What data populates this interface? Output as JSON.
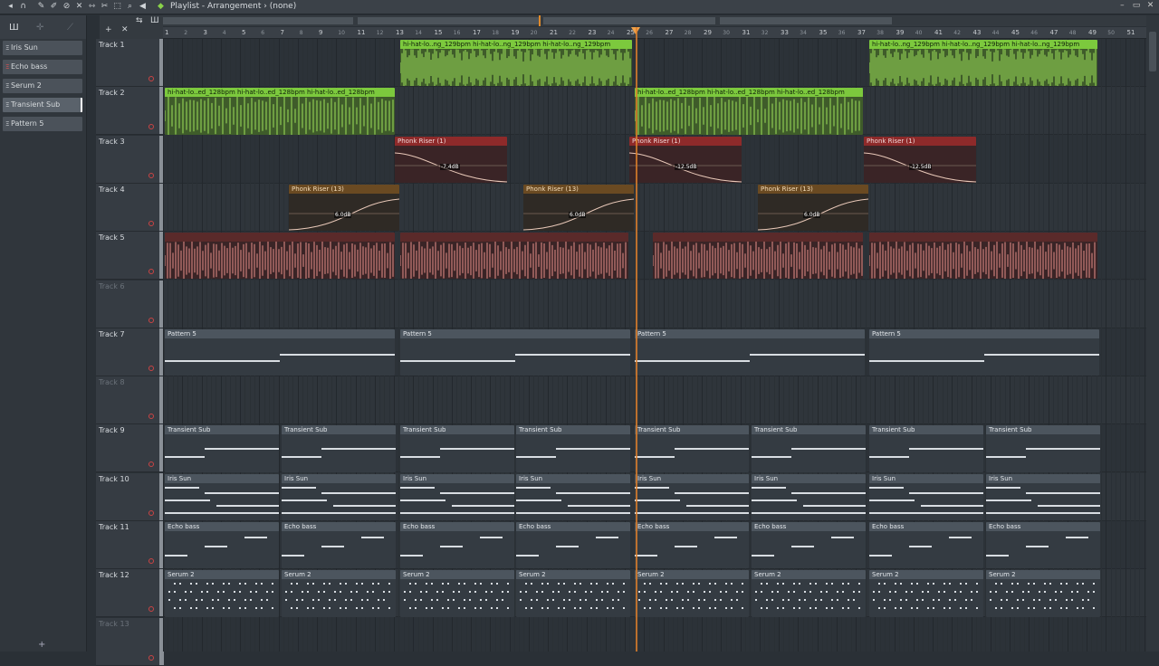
{
  "window": {
    "title": "Playlist - Arrangement",
    "subtitle": "(none)",
    "separator": "›"
  },
  "toolbar_icons": [
    "menu-icon",
    "magnet-icon",
    "pencil-icon",
    "brush-icon",
    "mute-icon",
    "delete-icon",
    "slip-icon",
    "select-icon",
    "zoom-icon",
    "speaker-icon"
  ],
  "picker": {
    "items": [
      {
        "label": "Iris Sun"
      },
      {
        "label": "Echo bass"
      },
      {
        "label": "Serum 2"
      },
      {
        "label": "Transient Sub",
        "selected": true
      },
      {
        "label": "Pattern 5"
      }
    ]
  },
  "ruler": {
    "bars": [
      "1",
      "3",
      "5",
      "7",
      "9",
      "11",
      "13",
      "15",
      "17",
      "19",
      "21",
      "23",
      "25",
      "27",
      "29",
      "31",
      "33",
      "35",
      "37",
      "39",
      "41",
      "43",
      "45",
      "47",
      "49",
      "51"
    ]
  },
  "tracks": [
    {
      "name": "Track 1"
    },
    {
      "name": "Track 2"
    },
    {
      "name": "Track 3"
    },
    {
      "name": "Track 4"
    },
    {
      "name": "Track 5"
    },
    {
      "name": "Track 6",
      "dim": true
    },
    {
      "name": "Track 7"
    },
    {
      "name": "Track 8",
      "dim": true
    },
    {
      "name": "Track 9"
    },
    {
      "name": "Track 10"
    },
    {
      "name": "Track 11"
    },
    {
      "name": "Track 12"
    },
    {
      "name": "Track 13",
      "dim": true
    }
  ],
  "clip_labels": {
    "hihat": "hi-hat-lo..ng_129bpm",
    "hihat2": "hi-hat-lo..ed_128bpm",
    "riser1": "Phonk Riser (1)",
    "riser13": "Phonk Riser (13)",
    "pattern5": "Pattern 5",
    "transient": "Transient Sub",
    "iris": "Iris Sun",
    "echo": "Echo bass",
    "serum": "Serum 2",
    "db_a": "-7.4dB",
    "db_b": "-12.5dB",
    "db_c": "6.0dB"
  },
  "colors": {
    "accent": "#e0802a",
    "green": "#7cc93d",
    "red": "#8e2a2a",
    "orange": "#6a4a22"
  }
}
